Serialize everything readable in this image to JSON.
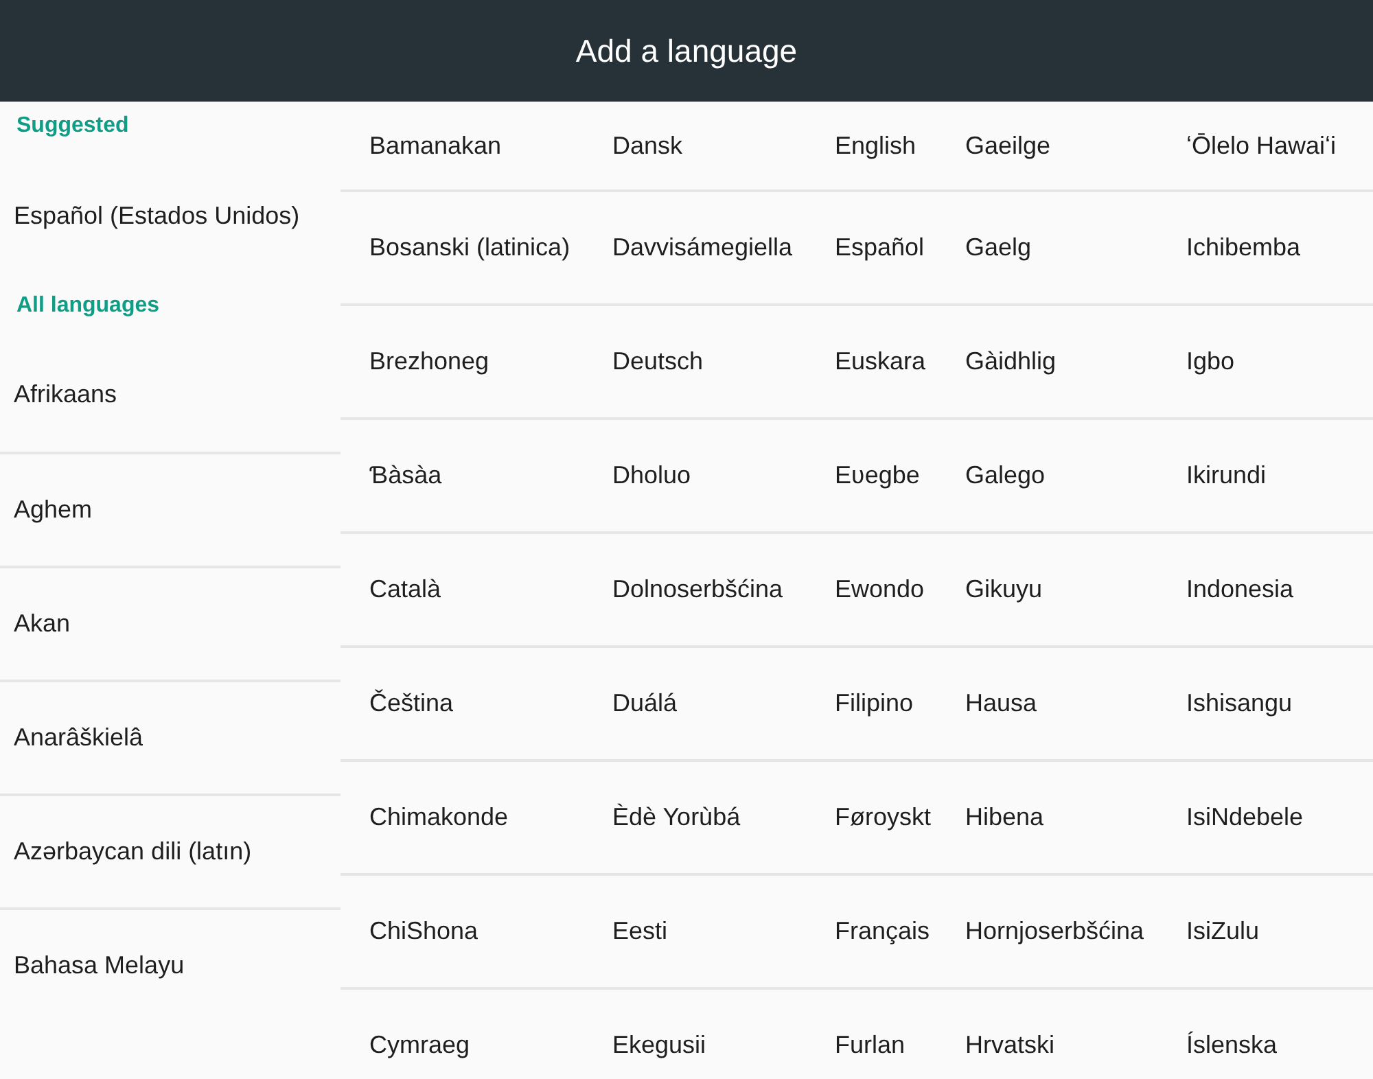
{
  "header": {
    "title": "Add a language"
  },
  "sidebar": {
    "sections": [
      {
        "heading": "Suggested",
        "items": [
          "Español (Estados Unidos)"
        ]
      },
      {
        "heading": "All languages",
        "items": [
          "Afrikaans",
          "Aghem",
          "Akan",
          "Anarâškielâ",
          "Azərbaycan dili (latın)",
          "Bahasa Melayu"
        ]
      }
    ]
  },
  "grid": {
    "rows": [
      [
        "Bamanakan",
        "Dansk",
        "English",
        "Gaeilge",
        "ʻŌlelo Hawaiʻi"
      ],
      [
        "Bosanski (latinica)",
        "Davvisámegiella",
        "Español",
        "Gaelg",
        "Ichibemba"
      ],
      [
        "Brezhoneg",
        "Deutsch",
        "Euskara",
        "Gàidhlig",
        "Igbo"
      ],
      [
        "Ɓàsàa",
        "Dholuo",
        "Eʋegbe",
        "Galego",
        "Ikirundi"
      ],
      [
        "Català",
        "Dolnoserbšćina",
        "Ewondo",
        "Gikuyu",
        "Indonesia"
      ],
      [
        "Čeština",
        "Duálá",
        "Filipino",
        "Hausa",
        "Ishisangu"
      ],
      [
        "Chimakonde",
        "Èdè Yorùbá",
        "Føroyskt",
        "Hibena",
        "IsiNdebele"
      ],
      [
        "ChiShona",
        "Eesti",
        "Français",
        "Hornjoserbšćina",
        "IsiZulu"
      ],
      [
        "Cymraeg",
        "Ekegusii",
        "Furlan",
        "Hrvatski",
        "Íslenska"
      ]
    ]
  }
}
